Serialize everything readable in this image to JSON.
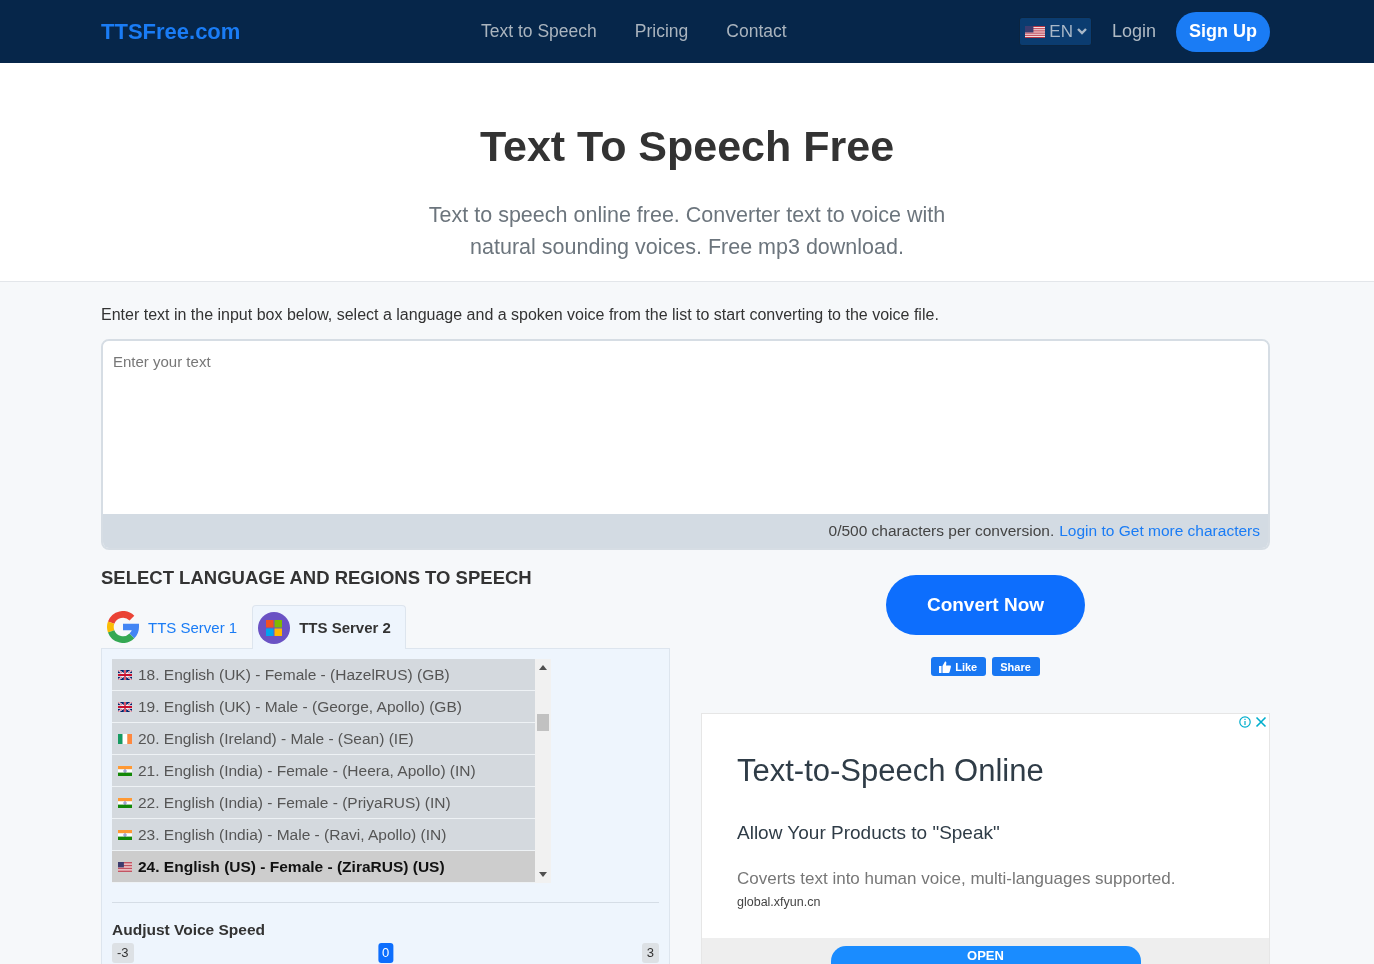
{
  "navbar": {
    "logo": "TTSFree.com",
    "links": [
      "Text to Speech",
      "Pricing",
      "Contact"
    ],
    "language": "EN",
    "login": "Login",
    "signup": "Sign Up"
  },
  "hero": {
    "title": "Text To Speech Free",
    "subtitle": "Text to speech online free. Converter text to voice with natural sounding voices. Free mp3 download."
  },
  "instructions": "Enter text in the input box below, select a language and a spoken voice from the list to start converting to the voice file.",
  "text_input": {
    "placeholder": "Enter your text",
    "counter": "0/500 characters per conversion.",
    "upgrade_link": "Login to Get more characters"
  },
  "voice_section": {
    "heading": "SELECT LANGUAGE AND REGIONS TO SPEECH",
    "tabs": [
      {
        "label": "TTS Server 1",
        "kind": "google",
        "selected": false
      },
      {
        "label": "TTS Server 2",
        "kind": "microsoft",
        "selected": true
      }
    ],
    "voices": [
      {
        "label": "18. English (UK) - Female - (HazelRUS) (GB)",
        "kind": "uk",
        "selected": false
      },
      {
        "label": "19. English (UK) - Male - (George, Apollo) (GB)",
        "kind": "uk",
        "selected": false
      },
      {
        "label": "20. English (Ireland) - Male - (Sean) (IE)",
        "kind": "ireland",
        "selected": false
      },
      {
        "label": "21. English (India) - Female - (Heera, Apollo) (IN)",
        "kind": "india",
        "selected": false
      },
      {
        "label": "22. English (India) - Female - (PriyaRUS) (IN)",
        "kind": "india",
        "selected": false
      },
      {
        "label": "23. English (India) - Male - (Ravi, Apollo) (IN)",
        "kind": "india",
        "selected": false
      },
      {
        "label": "24. English (US) - Female - (ZiraRUS) (US)",
        "kind": "us",
        "selected": true
      }
    ],
    "speed": {
      "label": "Audjust Voice Speed",
      "min": "-3",
      "value": "0",
      "max": "3",
      "level": 0.5
    }
  },
  "convert_button": "Convert Now",
  "social": {
    "like": "Like",
    "share": "Share"
  },
  "ad": {
    "title": "Text-to-Speech Online",
    "headline": "Allow Your Products to \"Speak\"",
    "description": "Coverts text into human voice, multi-languages supported.",
    "domain": "global.xfyun.cn",
    "button": "OPEN"
  }
}
